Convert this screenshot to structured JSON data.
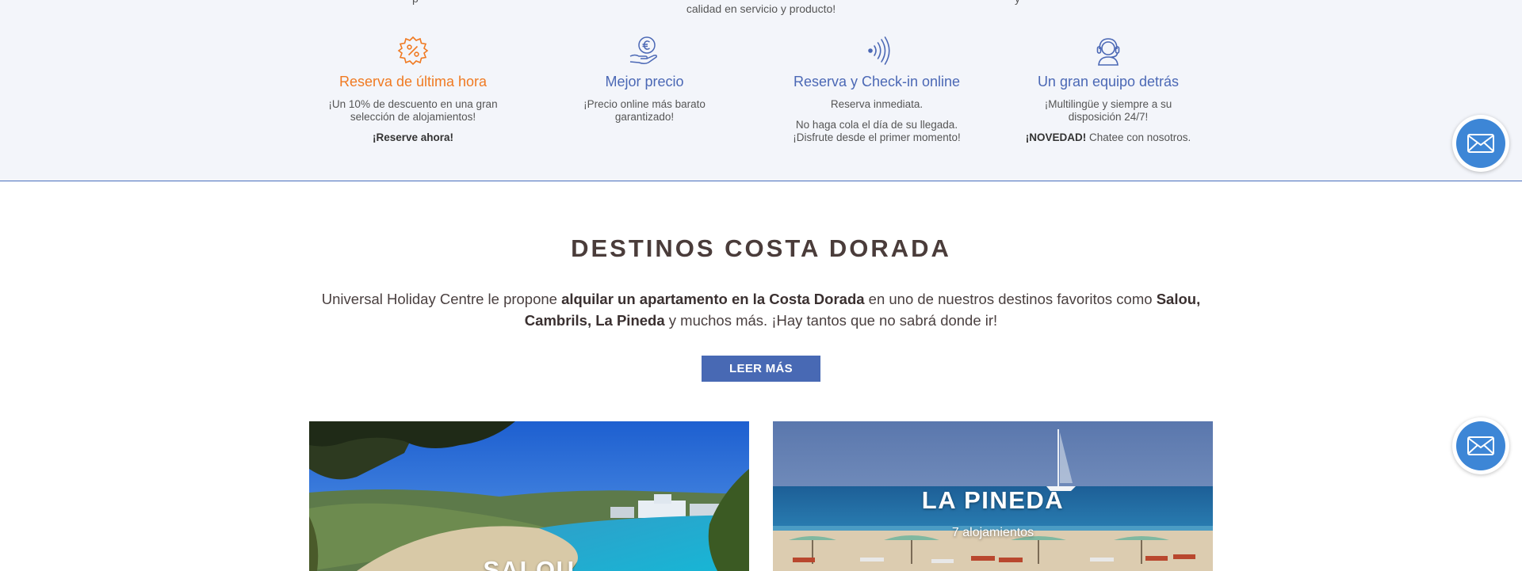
{
  "top_cut": {
    "left": "p",
    "middle": "calidad en servicio y producto!",
    "right": "y"
  },
  "features": [
    {
      "icon": "discount-badge-icon",
      "title": "Reserva de última hora",
      "text1": "¡Un 10% de descuento en una gran selección de alojamientos!",
      "text2": "¡Reserve ahora!"
    },
    {
      "icon": "euro-hand-icon",
      "title": "Mejor precio",
      "text1": "¡Precio online más barato garantizado!"
    },
    {
      "icon": "contactless-icon",
      "title": "Reserva y Check-in online",
      "text1": "Reserva inmediata.",
      "text2": "No haga cola el día de su llegada. ¡Disfrute desde el primer momento!"
    },
    {
      "icon": "headset-icon",
      "title": "Un gran equipo detrás",
      "text1": "¡Multilingüe y siempre a su disposición 24/7!",
      "text2_bold": "¡NOVEDAD!",
      "text2_rest": " Chatee con nosotros."
    }
  ],
  "section": {
    "title": "DESTINOS COSTA DORADA",
    "desc_1": "Universal Holiday Centre le propone ",
    "desc_2": "alquilar un apartamento en la Costa Dorada",
    "desc_3": " en uno de nuestros destinos favoritos como ",
    "desc_4": "Salou, Cambrils, La Pineda",
    "desc_5": " y muchos más. ¡Hay tantos que no sabrá donde ir!",
    "button": "LEER MÁS"
  },
  "cards": [
    {
      "name": "SALOU"
    },
    {
      "name": "LA PINEDA",
      "count": "7 alojamientos"
    }
  ],
  "colors": {
    "accent_blue": "#4869b4",
    "accent_orange": "#f07a22",
    "mail_blue": "#3d86d6"
  }
}
